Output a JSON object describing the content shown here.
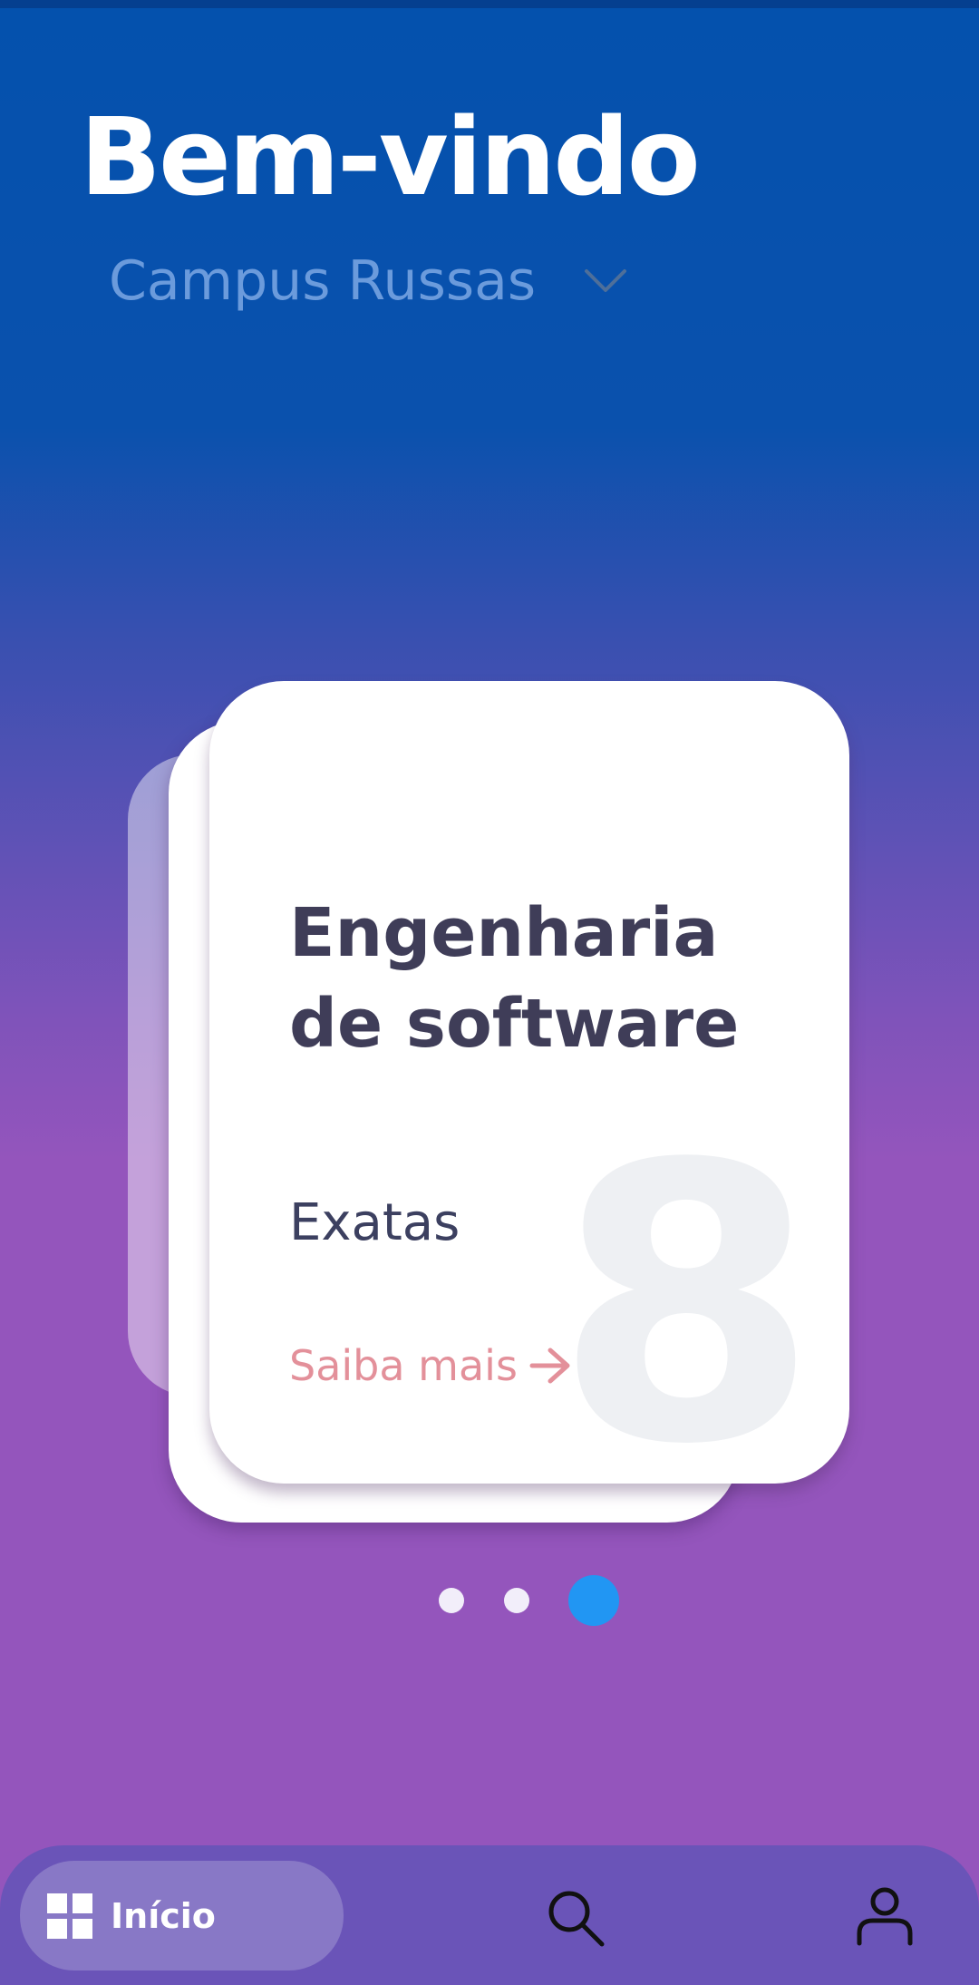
{
  "header": {
    "title": "Bem-vindo",
    "campus": "Campus Russas"
  },
  "card": {
    "course_name": "Engenharia de software",
    "area": "Exatas",
    "number": "8",
    "more_label": "Saiba mais"
  },
  "pager": {
    "total": 3,
    "active_index": 3
  },
  "bottom_nav": {
    "home_label": "Início",
    "items": [
      "grid-icon",
      "search-icon",
      "user-icon"
    ]
  },
  "colors": {
    "gradient_top": "#0451ad",
    "gradient_bottom": "#9455bc",
    "active_dot": "#2196f3",
    "link": "#e3909a",
    "nav_bar": "#6a54b8"
  }
}
